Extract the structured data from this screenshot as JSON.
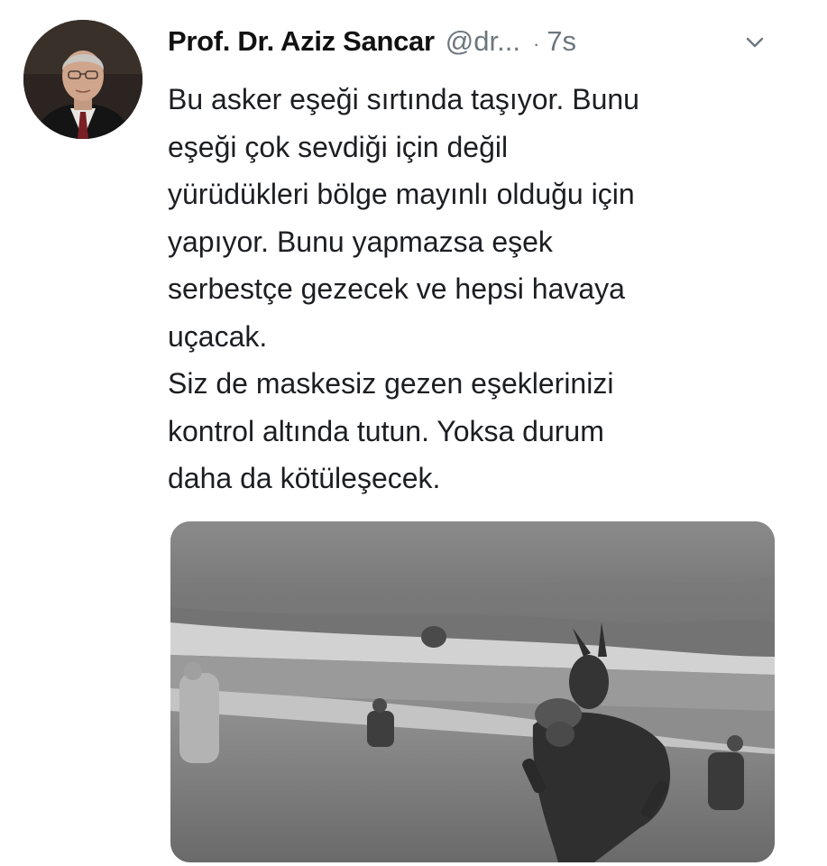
{
  "tweet": {
    "author_name": "Prof. Dr. Aziz Sancar",
    "handle": "@dr...",
    "separator": "·",
    "time": "7s",
    "menu_icon": "chevron-down-icon",
    "text_lines": [
      "Bu asker eşeği sırtında taşıyor. Bunu",
      "eşeği çok sevdiği için değil",
      "yürüdükleri bölge mayınlı olduğu için",
      "yapıyor. Bunu yapmazsa eşek",
      "serbestçe gezecek ve hepsi havaya",
      "uçacak.",
      "Siz de maskesiz gezen eşeklerinizi",
      "kontrol altında tutun. Yoksa durum",
      "daha da kötüleşecek."
    ]
  },
  "colors": {
    "text": "#1c1e21",
    "secondary": "#6e767d",
    "background": "#ffffff"
  }
}
